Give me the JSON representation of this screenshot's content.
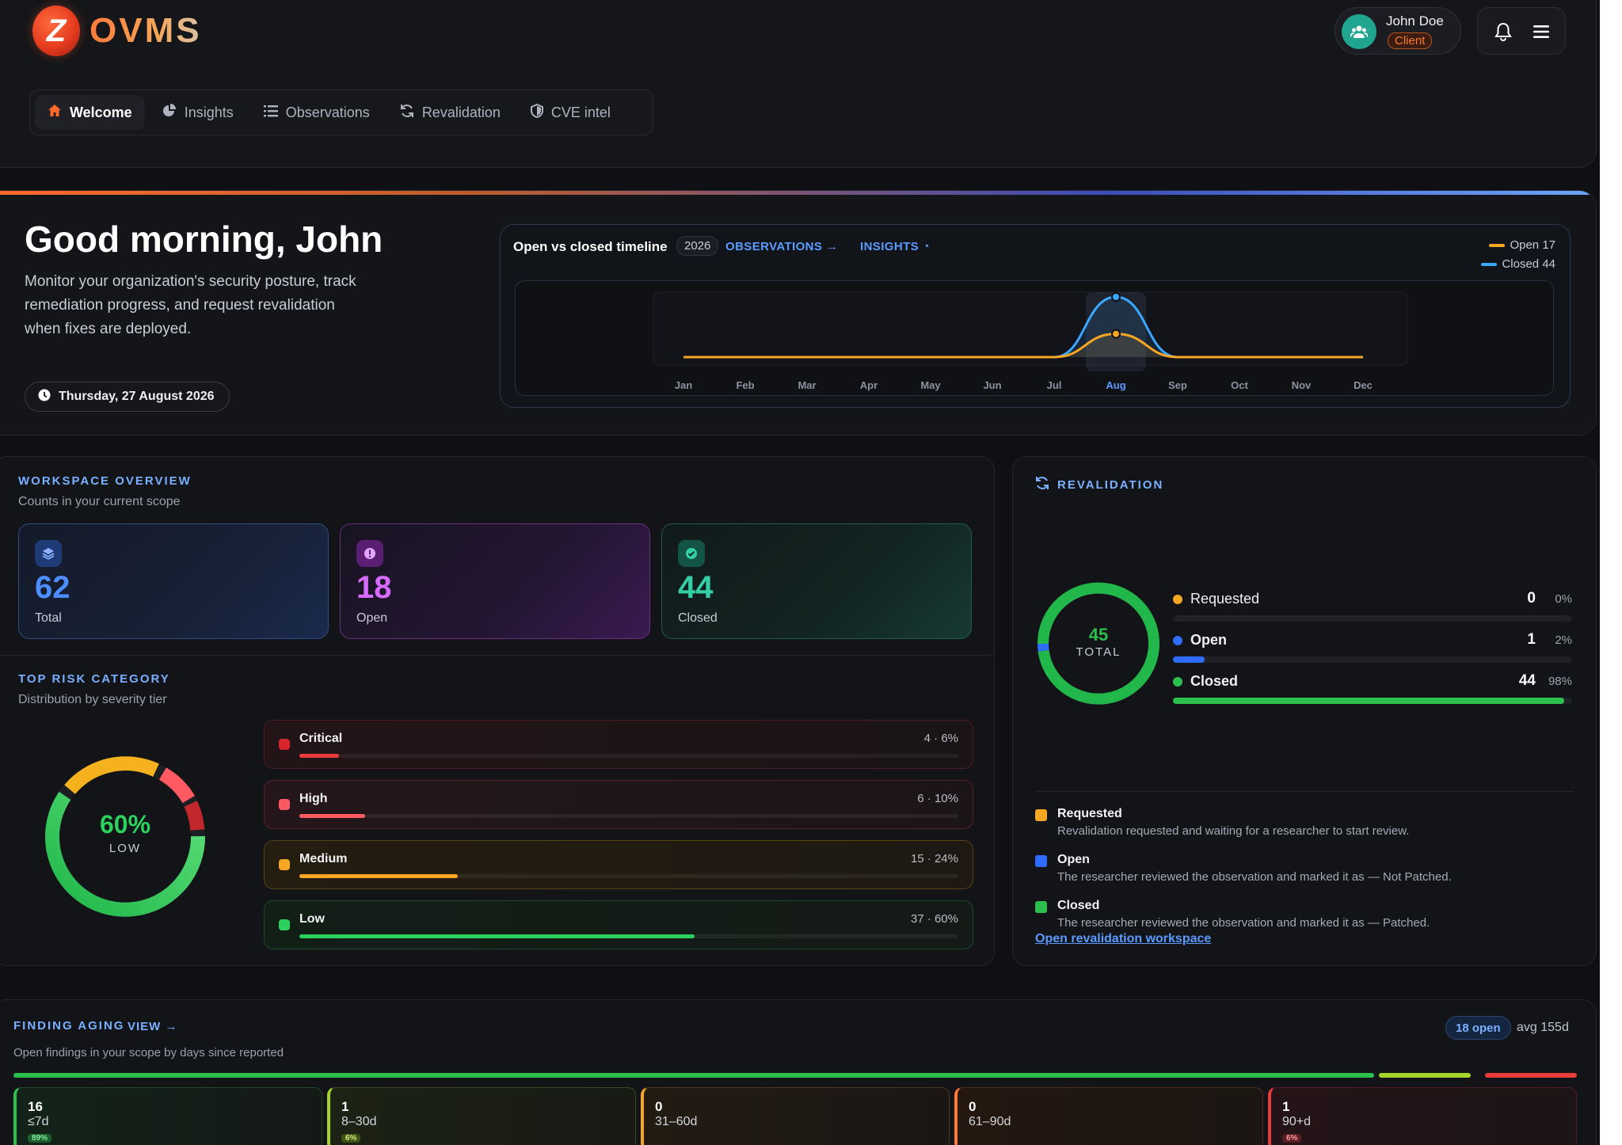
{
  "brand": {
    "logo_letter": "Z",
    "name": "OVMS"
  },
  "user": {
    "name": "John Doe",
    "role": "Client"
  },
  "nav": [
    {
      "label": "Welcome",
      "icon": "home-icon",
      "active": true
    },
    {
      "label": "Insights",
      "icon": "pie-chart-icon",
      "active": false
    },
    {
      "label": "Observations",
      "icon": "list-icon",
      "active": false
    },
    {
      "label": "Revalidation",
      "icon": "refresh-icon",
      "active": false
    },
    {
      "label": "CVE intel",
      "icon": "shield-icon",
      "active": false
    }
  ],
  "hero": {
    "greeting": "Good morning, John",
    "description": "Monitor your organization's security posture, track remediation progress, and request revalidation when fixes are deployed.",
    "date": "Thursday, 27 August 2026"
  },
  "timeline": {
    "title": "Open vs closed timeline",
    "year": "2026",
    "observations_link": "OBSERVATIONS →",
    "insights_link": "INSIGHTS ◔",
    "legend_open": "Open 17",
    "legend_closed": "Closed 44",
    "colors": {
      "open": "#f5a623",
      "closed": "#3aa8ff"
    }
  },
  "chart_data": {
    "type": "line",
    "x": [
      "Jan",
      "Feb",
      "Mar",
      "Apr",
      "May",
      "Jun",
      "Jul",
      "Aug",
      "Sep",
      "Oct",
      "Nov",
      "Dec"
    ],
    "highlight": "Aug",
    "series": [
      {
        "name": "Open",
        "values": [
          0,
          0,
          0,
          0,
          0,
          0,
          0,
          17,
          0,
          0,
          0,
          0
        ]
      },
      {
        "name": "Closed",
        "values": [
          0,
          0,
          0,
          0,
          0,
          0,
          0,
          44,
          0,
          0,
          0,
          0
        ]
      }
    ]
  },
  "overview": {
    "title": "WORKSPACE OVERVIEW",
    "subtitle": "Counts in your current scope",
    "stats": [
      {
        "value": "62",
        "label": "Total",
        "icon": "layers-icon",
        "color": "#4c8dff"
      },
      {
        "value": "18",
        "label": "Open",
        "icon": "alert-icon",
        "color": "#d86bff"
      },
      {
        "value": "44",
        "label": "Closed",
        "icon": "check-icon",
        "color": "#33d0a8"
      }
    ]
  },
  "risk": {
    "title": "TOP RISK CATEGORY",
    "subtitle": "Distribution by severity tier",
    "donut_pct": "60%",
    "donut_label": "LOW",
    "tiers": [
      {
        "name": "Critical",
        "value": "4 · 6%",
        "pct": 6,
        "color": "#ea3b3b"
      },
      {
        "name": "High",
        "value": "6 · 10%",
        "pct": 10,
        "color": "#ff5a62"
      },
      {
        "name": "Medium",
        "value": "15 · 24%",
        "pct": 24,
        "color": "#f5a623"
      },
      {
        "name": "Low",
        "value": "37 · 60%",
        "pct": 60,
        "color": "#2bd15c"
      }
    ]
  },
  "revalidation": {
    "title": "REVALIDATION",
    "total": "45",
    "total_label": "TOTAL",
    "rows": [
      {
        "name": "Requested",
        "count": "0",
        "pct_label": "0%",
        "pct": 0,
        "color": "#f5a623"
      },
      {
        "name": "Open",
        "count": "1",
        "pct_label": "2%",
        "pct": 2,
        "color": "#2f6cff"
      },
      {
        "name": "Closed",
        "count": "44",
        "pct_label": "98%",
        "pct": 98,
        "color": "#2bc04d"
      }
    ],
    "definitions": [
      {
        "title": "Requested",
        "text": "Revalidation requested and waiting for a researcher to start review.",
        "color": "#f5a623"
      },
      {
        "title": "Open",
        "text": "The researcher reviewed the observation and marked it as — Not Patched.",
        "color": "#2f6cff"
      },
      {
        "title": "Closed",
        "text": "The researcher reviewed the observation and marked it as — Patched.",
        "color": "#2bc04d"
      }
    ],
    "link": "Open revalidation workspace"
  },
  "aging": {
    "title": "FINDING AGING",
    "view_link": "VIEW →",
    "subtitle": "Open findings in your scope by days since reported",
    "open_badge": "18 open",
    "avg": "avg 155d",
    "buckets": [
      {
        "count": "16",
        "range": "≤7d",
        "pct": "89%",
        "share": 89,
        "color": "#2bc04d"
      },
      {
        "count": "1",
        "range": "8–30d",
        "pct": "6%",
        "share": 6,
        "color": "#a5d42a"
      },
      {
        "count": "0",
        "range": "31–60d",
        "pct": "",
        "share": 0,
        "color": "#f5a623"
      },
      {
        "count": "0",
        "range": "61–90d",
        "pct": "",
        "share": 0,
        "color": "#ff7a2e"
      },
      {
        "count": "1",
        "range": "90+d",
        "pct": "6%",
        "share": 6,
        "color": "#ea3b3b"
      }
    ]
  }
}
